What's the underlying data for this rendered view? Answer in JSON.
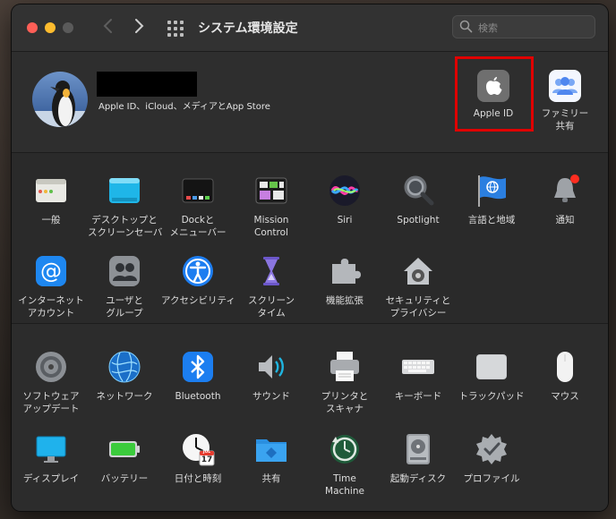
{
  "window": {
    "title": "システム環境設定"
  },
  "search": {
    "placeholder": "検索"
  },
  "account": {
    "subtitle": "Apple ID、iCloud、メディアとApp Store",
    "apple_id": {
      "label": "Apple ID"
    },
    "family": {
      "label1": "ファミリー",
      "label2": "共有"
    }
  },
  "prefs_row1": [
    {
      "l1": "一般",
      "l2": ""
    },
    {
      "l1": "デスクトップと",
      "l2": "スクリーンセーバ"
    },
    {
      "l1": "Dockと",
      "l2": "メニューバー"
    },
    {
      "l1": "Mission",
      "l2": "Control"
    },
    {
      "l1": "Siri",
      "l2": ""
    },
    {
      "l1": "Spotlight",
      "l2": ""
    },
    {
      "l1": "言語と地域",
      "l2": ""
    },
    {
      "l1": "通知",
      "l2": ""
    }
  ],
  "prefs_row2": [
    {
      "l1": "インターネット",
      "l2": "アカウント"
    },
    {
      "l1": "ユーザと",
      "l2": "グループ"
    },
    {
      "l1": "アクセシビリティ",
      "l2": ""
    },
    {
      "l1": "スクリーン",
      "l2": "タイム"
    },
    {
      "l1": "機能拡張",
      "l2": ""
    },
    {
      "l1": "セキュリティと",
      "l2": "プライバシー"
    }
  ],
  "prefs_row3": [
    {
      "l1": "ソフトウェア",
      "l2": "アップデート"
    },
    {
      "l1": "ネットワーク",
      "l2": ""
    },
    {
      "l1": "Bluetooth",
      "l2": ""
    },
    {
      "l1": "サウンド",
      "l2": ""
    },
    {
      "l1": "プリンタと",
      "l2": "スキャナ"
    },
    {
      "l1": "キーボード",
      "l2": ""
    },
    {
      "l1": "トラックパッド",
      "l2": ""
    },
    {
      "l1": "マウス",
      "l2": ""
    }
  ],
  "prefs_row4": [
    {
      "l1": "ディスプレイ",
      "l2": ""
    },
    {
      "l1": "バッテリー",
      "l2": ""
    },
    {
      "l1": "日付と時刻",
      "l2": ""
    },
    {
      "l1": "共有",
      "l2": ""
    },
    {
      "l1": "Time",
      "l2": "Machine"
    },
    {
      "l1": "起動ディスク",
      "l2": ""
    },
    {
      "l1": "プロファイル",
      "l2": ""
    }
  ],
  "calendar": {
    "month": "JUL",
    "day": "17"
  }
}
